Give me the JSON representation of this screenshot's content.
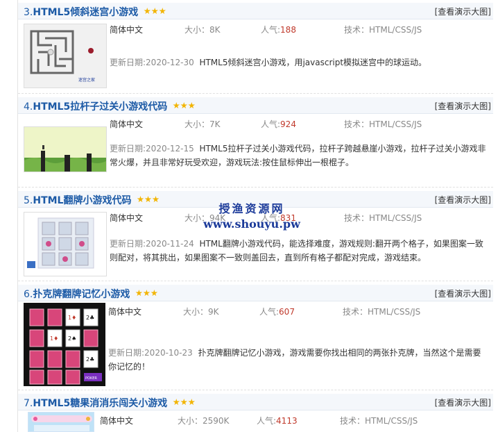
{
  "common": {
    "demo_label": "[查看演示大图]",
    "lang": "简体中文",
    "size_label": "大小：",
    "pop_label": "人气:",
    "tech_label": "技术：",
    "date_label": "更新日期:"
  },
  "items": [
    {
      "index": "3.",
      "title": "HTML5倾斜迷宫小游戏",
      "rating": 3,
      "size": "8K",
      "pop": "188",
      "tech": "HTML/CSS/JS",
      "date": "2020-12-30",
      "desc": "HTML5倾斜迷宫小游戏，用javascript模拟迷宫中的球运动。"
    },
    {
      "index": "4.",
      "title": "HTML5拉杆子过关小游戏代码",
      "rating": 3,
      "size": "7K",
      "pop": "924",
      "tech": "HTML/CSS/JS",
      "date": "2020-12-15",
      "desc": "HTML5拉杆子过关小游戏代码，拉杆子跨越悬崖小游戏，拉杆子过关小游戏非常火爆，并且非常好玩受欢迎，游戏玩法:按住鼠标伸出一根棍子。"
    },
    {
      "index": "5.",
      "title": "HTML翻牌小游戏代码",
      "rating": 3,
      "size": "94K",
      "pop": "831",
      "tech": "HTML/CSS/JS",
      "date": "2020-11-24",
      "desc": "HTML翻牌小游戏代码，能选择难度，游戏规则:翻开两个格子，如果图案一致则配对，将其挑出，如果图案不一致则盖回去，直到所有格子都配对完成，游戏结束。"
    },
    {
      "index": "6.",
      "title": "扑克牌翻牌记忆小游戏",
      "rating": 3,
      "size": "9K",
      "pop": "607",
      "tech": "HTML/CSS/JS",
      "date": "2020-10-23",
      "desc": "扑克牌翻牌记忆小游戏，游戏需要你找出相同的两张扑克牌，当然这个是需要你记忆的！"
    },
    {
      "index": "7.",
      "title": "HTML5糖果消消乐闯关小游戏",
      "rating": 3,
      "size": "2590K",
      "pop": "4113",
      "tech": "HTML/CSS/JS"
    }
  ],
  "thumbs": {
    "maze_caption": "迷宫之家",
    "poker_caption": "POKER",
    "card_ranks": [
      "1♦",
      "2♣",
      "1♦",
      "2♠",
      "2♣",
      "2♠"
    ]
  },
  "watermark": {
    "line1": "授渔资源网",
    "line2": "www.shouyu.pw"
  },
  "colors": {
    "title": "#1c5aa6",
    "popularity": "#c0392b",
    "header_bg": "#f4f7fb",
    "star": "#f2b400"
  }
}
